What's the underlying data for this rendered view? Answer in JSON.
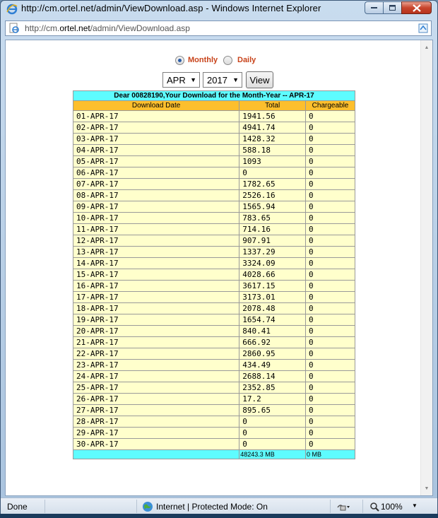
{
  "window": {
    "title": "http://cm.ortel.net/admin/ViewDownload.asp - Windows Internet Explorer",
    "address": {
      "prefix": "http://cm.",
      "host": "ortel.net",
      "path": "/admin/ViewDownload.asp"
    }
  },
  "options": {
    "monthly_label": "Monthly",
    "daily_label": "Daily",
    "selected": "monthly"
  },
  "filters": {
    "month": "APR",
    "year": "2017",
    "view_label": "View"
  },
  "table": {
    "caption": "Dear 00828190,Your Download for the Month-Year -- APR-17",
    "headers": [
      "Download Date",
      "Total",
      "Chargeable"
    ],
    "rows": [
      [
        "01-APR-17",
        "1941.56",
        "0"
      ],
      [
        "02-APR-17",
        "4941.74",
        "0"
      ],
      [
        "03-APR-17",
        "1428.32",
        "0"
      ],
      [
        "04-APR-17",
        "588.18",
        "0"
      ],
      [
        "05-APR-17",
        "1093",
        "0"
      ],
      [
        "06-APR-17",
        "0",
        "0"
      ],
      [
        "07-APR-17",
        "1782.65",
        "0"
      ],
      [
        "08-APR-17",
        "2526.16",
        "0"
      ],
      [
        "09-APR-17",
        "1565.94",
        "0"
      ],
      [
        "10-APR-17",
        "783.65",
        "0"
      ],
      [
        "11-APR-17",
        "714.16",
        "0"
      ],
      [
        "12-APR-17",
        "907.91",
        "0"
      ],
      [
        "13-APR-17",
        "1337.29",
        "0"
      ],
      [
        "14-APR-17",
        "3324.09",
        "0"
      ],
      [
        "15-APR-17",
        "4028.66",
        "0"
      ],
      [
        "16-APR-17",
        "3617.15",
        "0"
      ],
      [
        "17-APR-17",
        "3173.01",
        "0"
      ],
      [
        "18-APR-17",
        "2078.48",
        "0"
      ],
      [
        "19-APR-17",
        "1654.74",
        "0"
      ],
      [
        "20-APR-17",
        "840.41",
        "0"
      ],
      [
        "21-APR-17",
        "666.92",
        "0"
      ],
      [
        "22-APR-17",
        "2860.95",
        "0"
      ],
      [
        "23-APR-17",
        "434.49",
        "0"
      ],
      [
        "24-APR-17",
        "2688.14",
        "0"
      ],
      [
        "25-APR-17",
        "2352.85",
        "0"
      ],
      [
        "26-APR-17",
        "17.2",
        "0"
      ],
      [
        "27-APR-17",
        "895.65",
        "0"
      ],
      [
        "28-APR-17",
        "0",
        "0"
      ],
      [
        "29-APR-17",
        "0",
        "0"
      ],
      [
        "30-APR-17",
        "0",
        "0"
      ]
    ],
    "footer": [
      "",
      "48243.3 MB",
      "0 MB"
    ]
  },
  "status": {
    "text": "Done",
    "zone": "Internet | Protected Mode: On",
    "zoom": "100%"
  },
  "colors": {
    "caption_bg": "#5efcff",
    "header_bg": "#fdbf2d",
    "row_bg": "#ffffcc",
    "radio_label": "#c8431a"
  },
  "icons": {
    "title": "ie-logo-icon",
    "address": "page-icon",
    "compat": "compatibility-view-icon",
    "zone": "globe-icon",
    "zoom": "magnifier-icon"
  }
}
